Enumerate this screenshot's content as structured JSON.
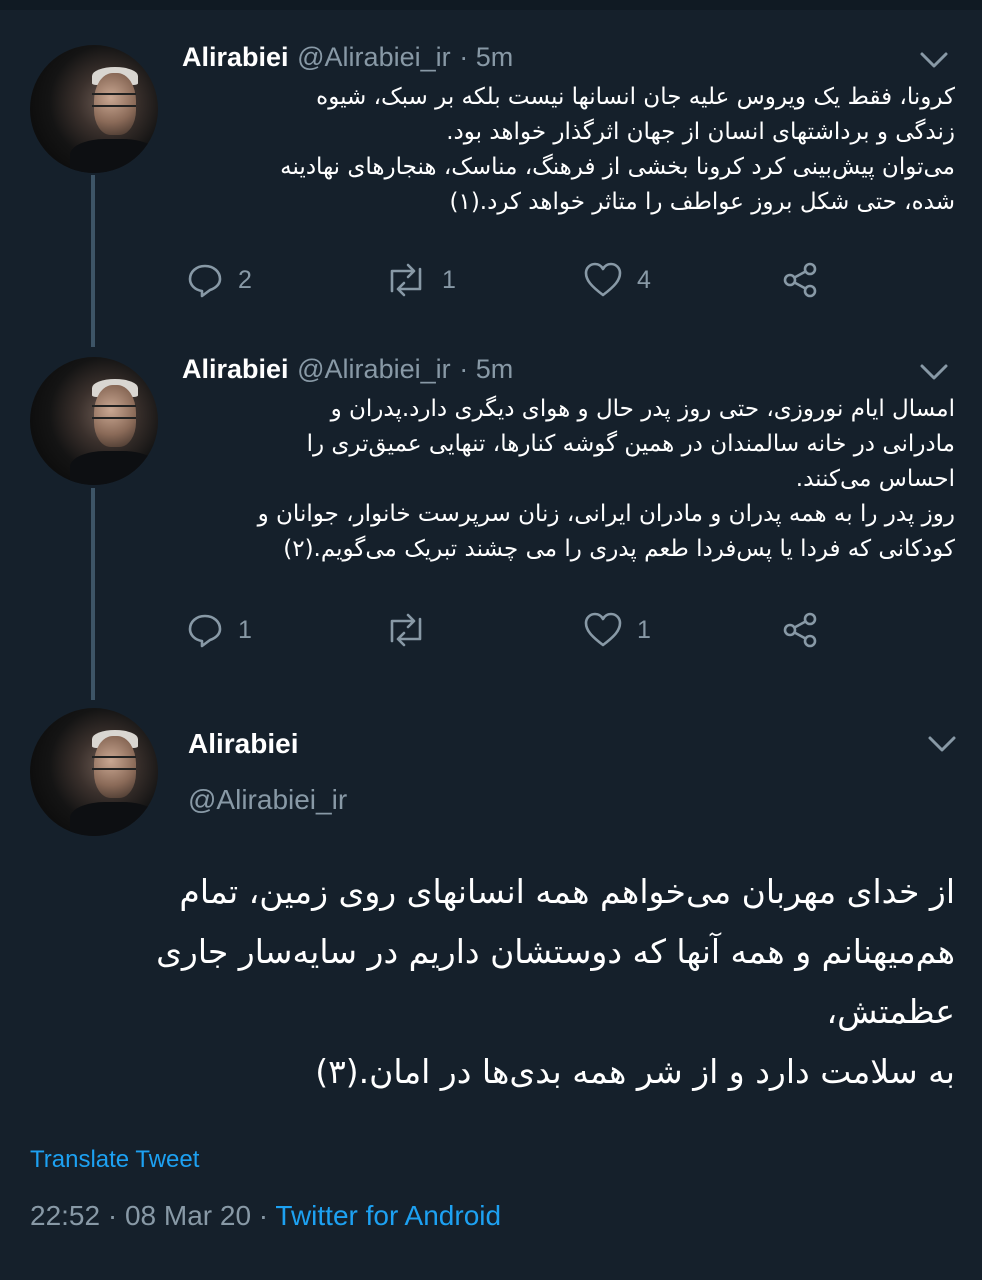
{
  "tweets": [
    {
      "name": "Alirabiei",
      "handle": "@Alirabiei_ir",
      "age": "· 5m",
      "lines": [
        "کرونا، فقط یک  ویروس علیه جان انسانها نیست بلکه بر سبک، شیوه",
        "زندگی و برداشتهای انسان از جهان اثرگذار خواهد بود.",
        "می‌توان پیش‌بینی کرد کرونا  بخشی از فرهنگ، مناسک، هنجارهای نهادینه",
        "شده، حتی شکل بروز عواطف را متاثر خواهد کرد.(۱)"
      ],
      "replies": "2",
      "retweets": "1",
      "likes": "4"
    },
    {
      "name": "Alirabiei",
      "handle": "@Alirabiei_ir",
      "age": "· 5m",
      "lines": [
        "امسال ایام نوروزی، حتی روز پدر حال و هوای دیگری دارد.پدران و",
        "مادرانی در خانه سالمندان در همین گوشه کنارها، تنهایی عمیق‌تری را",
        "احساس می‌کنند.",
        " روز پدر را به همه پدران و مادران ایرانی، زنان سرپرست خانوار، جوانان و",
        "کودکانی که فردا یا پس‌فردا طعم پدری را می چشند تبریک می‌گویم.(۲)"
      ],
      "replies": "1",
      "retweets": "",
      "likes": "1"
    }
  ],
  "main_tweet": {
    "name": "Alirabiei",
    "handle": "@Alirabiei_ir",
    "lines": [
      "از خدای مهربان می‌خواهم همه انسانهای روی زمین، تمام",
      "هم‌میهنانم و همه آنها که دوستشان داریم در سایه‌سار جاری",
      "عظمتش،",
      "به سلامت دارد و از شر همه بدی‌ها در امان.(۳)"
    ],
    "translate": "Translate Tweet",
    "timestamp": "22:52 · 08 Mar 20 · ",
    "source": "Twitter for Android"
  },
  "icons": {
    "reply": "reply-icon",
    "retweet": "retweet-icon",
    "like": "heart-icon",
    "share": "share-icon",
    "more": "chevron-down-icon"
  },
  "colors": {
    "background": "#15202b",
    "muted": "#8899a6",
    "link": "#1da1f2",
    "thread_line": "#3d5466"
  }
}
